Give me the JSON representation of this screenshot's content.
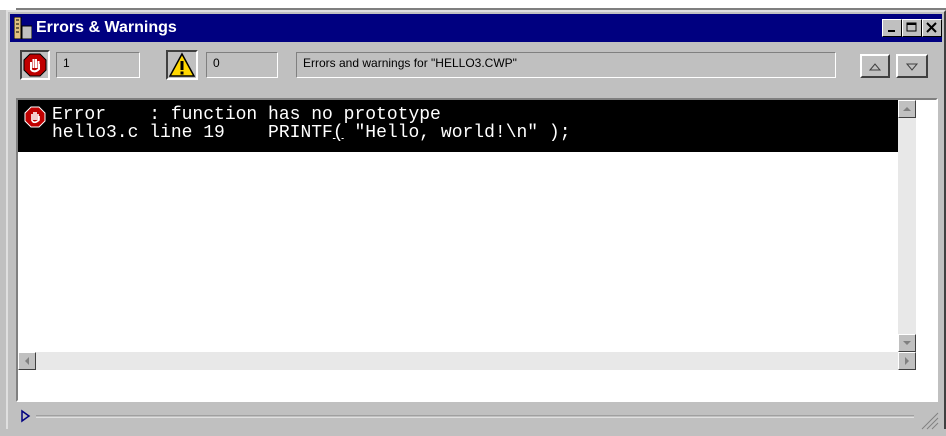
{
  "window": {
    "title": "Errors & Warnings"
  },
  "toolbar": {
    "error_count": "1",
    "warning_count": "0",
    "status_text": "Errors and warnings for \"HELLO3.CWP\""
  },
  "messages": [
    {
      "type": "Error",
      "line1": "Error    : function has no prototype",
      "line2_prefix": "hello3.c line 19    PRINTF",
      "line2_cursor": "(",
      "line2_suffix": " \"Hello, world!\\n\" );"
    }
  ],
  "colors": {
    "titlebar": "#000080",
    "selected_row": "#000000",
    "window_face": "#c0c0c0"
  }
}
